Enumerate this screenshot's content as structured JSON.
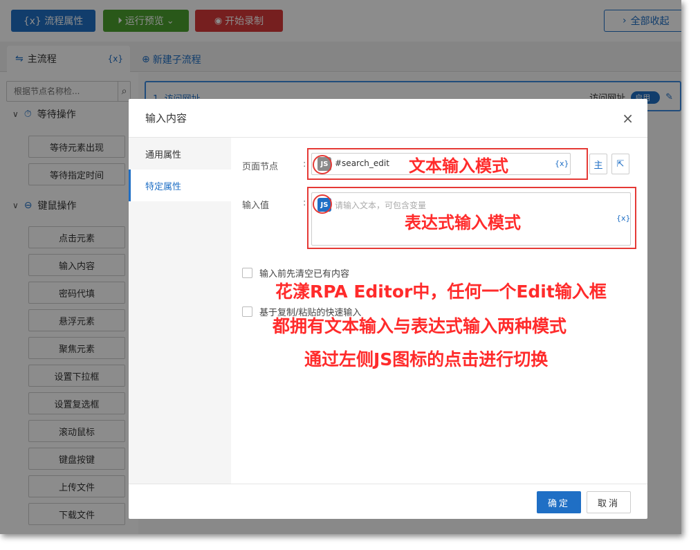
{
  "toolbar": {
    "flow_props": "{x} 流程属性",
    "run_preview": "运行预览",
    "start_record": "开始录制",
    "collapse_all": "全部收起"
  },
  "tabs": {
    "main_flow": "主流程",
    "var_icon": "{x}",
    "new_subflow": "新建子流程"
  },
  "sidebar": {
    "search_placeholder": "根据节点名称检...",
    "groups": [
      {
        "label": "等待操作",
        "items": [
          "等待元素出现",
          "等待指定时间"
        ]
      },
      {
        "label": "键鼠操作",
        "items": [
          "点击元素",
          "输入内容",
          "密码代填",
          "悬浮元素",
          "聚焦元素",
          "设置下拉框",
          "设置复选框",
          "滚动鼠标",
          "键盘按键",
          "上传文件",
          "下载文件"
        ]
      }
    ]
  },
  "flow": {
    "step1_name": "1. 访问网址",
    "step1_type": "访问网址",
    "step1_toggle": "启用"
  },
  "dialog": {
    "title": "输入内容",
    "close": "×",
    "nav": [
      "通用属性",
      "特定属性"
    ],
    "page_node_label": "页面节点",
    "page_node_value": "#search_edit",
    "input_value_label": "输入值",
    "input_value_placeholder": "请输入文本，可包含变量",
    "var_btn": "{x}",
    "main_btn": "主",
    "js_badge": "JS",
    "checkbox1": "输入前先清空已有内容",
    "checkbox2": "基于复制/粘贴的快速输入",
    "ok": "确定",
    "cancel": "取消"
  },
  "annotations": {
    "text_mode": "文本输入模式",
    "expr_mode": "表达式输入模式",
    "line1": "花漾RPA Editor中，任何一个Edit输入框",
    "line2": "都拥有文本输入与表达式输入两种模式",
    "line3": "通过左侧JS图标的点击进行切换"
  }
}
